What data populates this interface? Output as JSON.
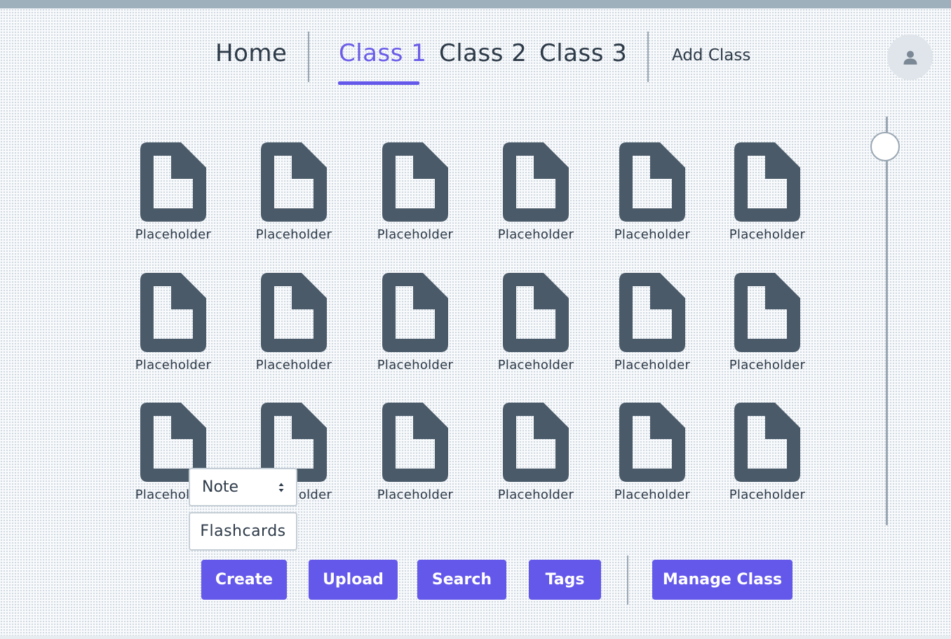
{
  "nav": {
    "home": "Home",
    "classes": [
      "Class 1",
      "Class 2",
      "Class 3"
    ],
    "active_class": "Class 1",
    "add_class": "Add Class"
  },
  "user": {
    "avatar_icon": "user-icon"
  },
  "files": {
    "icon": "file-icon",
    "items": [
      "Placeholder",
      "Placeholder",
      "Placeholder",
      "Placeholder",
      "Placeholder",
      "Placeholder",
      "Placeholder",
      "Placeholder",
      "Placeholder",
      "Placeholder",
      "Placeholder",
      "Placeholder",
      "Placeholder",
      "Placeholder",
      "Placeholder",
      "Placeholder",
      "Placeholder",
      "Placeholder"
    ]
  },
  "create_menu": {
    "type_select": "Note",
    "flashcards": "Flashcards"
  },
  "toolbar": {
    "create": "Create",
    "upload": "Upload",
    "search": "Search",
    "tags": "Tags",
    "manage_class": "Manage Class"
  },
  "colors": {
    "accent": "#6458eb",
    "active_tab_text": "#6a5ce8",
    "icon": "#4a5a69",
    "text": "#2d3a48"
  },
  "zoom_slider": {
    "level": 0.08
  }
}
